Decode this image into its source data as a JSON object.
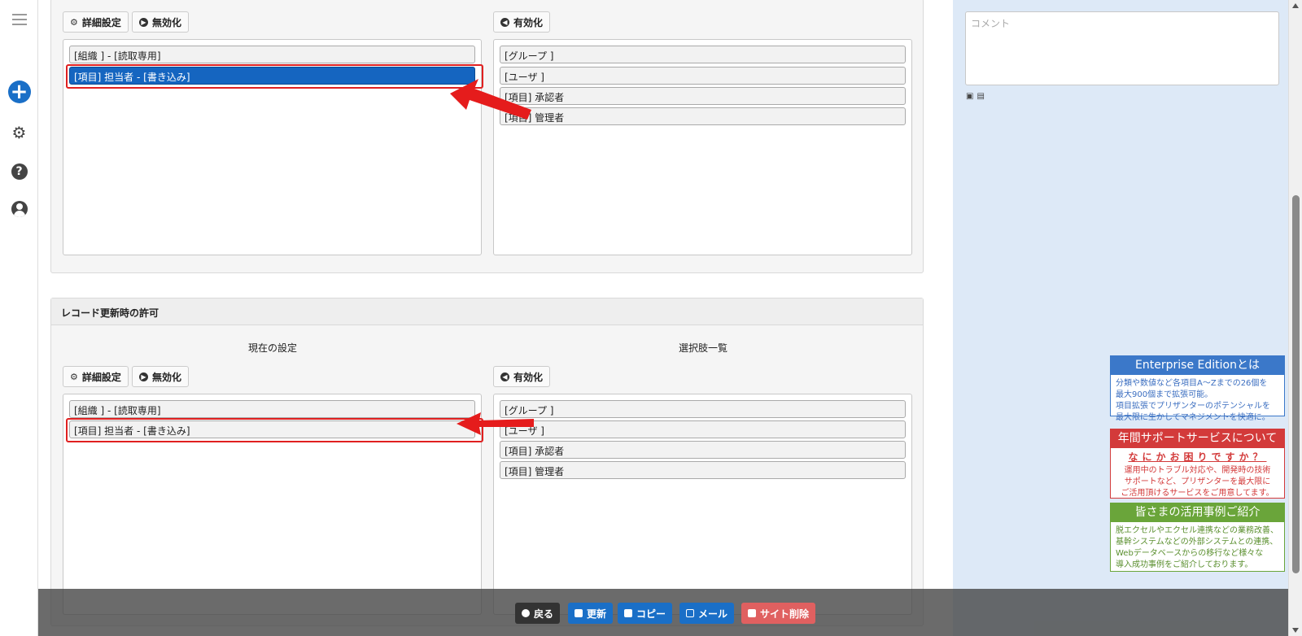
{
  "comment_placeholder": "コメント",
  "buttons": {
    "detail": "詳細設定",
    "disable": "無効化",
    "enable": "有効化"
  },
  "section_bottom": {
    "legend": "レコード更新時の許可",
    "current_header": "現在の設定",
    "choices_header": "選択肢一覧"
  },
  "current_items": [
    "[組織 ] - [読取専用]",
    "[項目] 担当者 - [書き込み]"
  ],
  "choice_items": [
    "[グループ ]",
    "[ユーザ ]",
    "[項目] 承認者",
    "[項目] 管理者"
  ],
  "actions": {
    "back": "戻る",
    "update": "更新",
    "copy": "コピー",
    "mail": "メール",
    "delete": "サイト削除"
  },
  "promos": [
    {
      "title": "Enterprise Editionとは",
      "lines": [
        "分類や数値など各項目A～Zまでの26個を",
        "最大900個まで拡張可能。",
        "項目拡張でプリザンターのポテンシャルを",
        "最大限に生かしてマネジメントを快適に。"
      ]
    },
    {
      "title": "年間サポートサービスについて",
      "subtitle": "なにかお困りですか？",
      "lines": [
        "運用中のトラブル対応や、開発時の技術",
        "サポートなど、プリザンターを最大限に",
        "ご活用頂けるサービスをご用意してます。"
      ]
    },
    {
      "title": "皆さまの活用事例ご紹介",
      "lines": [
        "脱エクセルやエクセル連携などの業務改善、",
        "基幹システムなどの外部システムとの連携、",
        "Webデータベースからの移行など様々な",
        "導入成功事例をご紹介しております。"
      ]
    }
  ],
  "colors": {
    "selected": "#1565c0",
    "primary": "#1a6fc7",
    "danger": "#e06060",
    "highlight": "#e02020"
  }
}
